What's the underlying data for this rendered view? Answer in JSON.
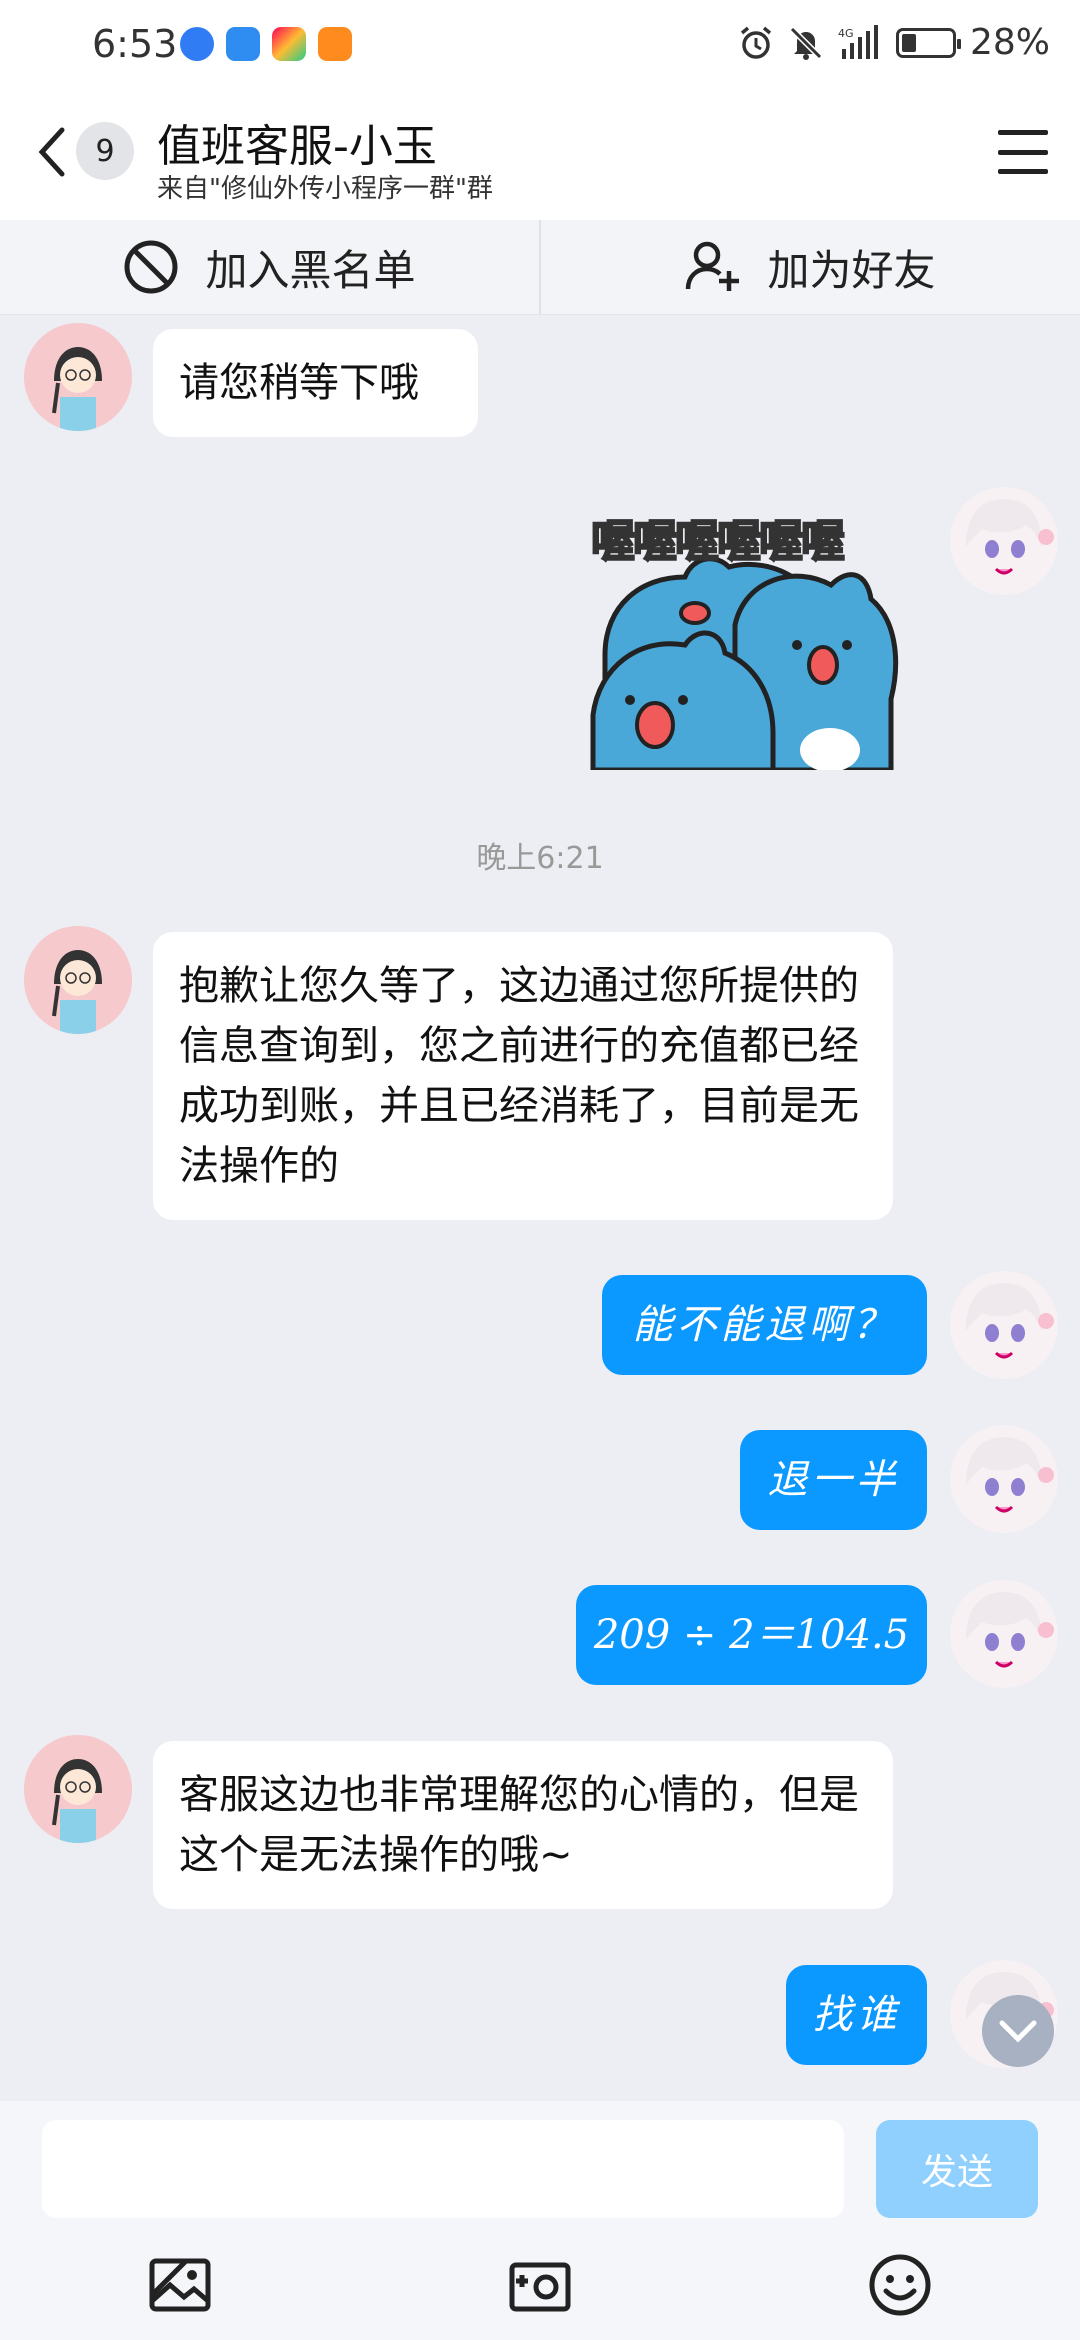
{
  "status_bar": {
    "time": "6:53",
    "battery": "28%",
    "battery_level": 0.28,
    "network": "4G"
  },
  "header": {
    "unread_count": "9",
    "title": "值班客服-小玉",
    "subtitle": "来自\"修仙外传小程序一群\"群"
  },
  "actions": {
    "blacklist": "加入黑名单",
    "add_friend": "加为好友"
  },
  "messages": [
    {
      "from": "agent",
      "text": "请您稍等下哦"
    },
    {
      "from": "me",
      "type": "sticker",
      "text": "喔喔喔喔喔喔"
    },
    {
      "type": "time",
      "text": "晚上6:21"
    },
    {
      "from": "agent",
      "text": "抱歉让您久等了，这边通过您所提供的信息查询到，您之前进行的充值都已经成功到账，并且已经消耗了，目前是无法操作的"
    },
    {
      "from": "me",
      "text": "能不能退啊？"
    },
    {
      "from": "me",
      "text": "退一半"
    },
    {
      "from": "me",
      "text": "209 ÷ 2＝104.5"
    },
    {
      "from": "agent",
      "text": "客服这边也非常理解您的心情的，但是这个是无法操作的哦~"
    },
    {
      "from": "me",
      "text": "找谁"
    }
  ],
  "input": {
    "value": "",
    "placeholder": "",
    "send_label": "发送"
  },
  "colors": {
    "outgoing_bubble": "#0b99ff",
    "incoming_bubble": "#ffffff",
    "chat_background": "#edeef3",
    "send_button_disabled": "#8fd0ff"
  },
  "icons": [
    "back-icon",
    "menu-icon",
    "block-icon",
    "add-person-icon",
    "image-icon",
    "camera-icon",
    "emoji-icon",
    "chevron-down-icon"
  ]
}
